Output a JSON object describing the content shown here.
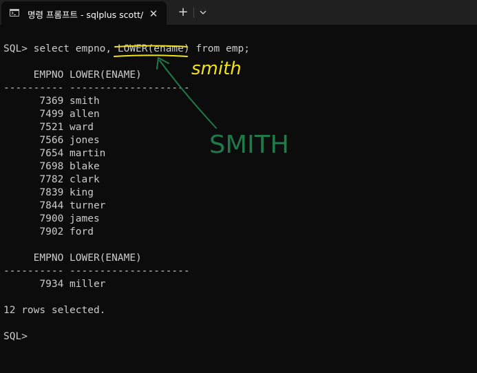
{
  "tab": {
    "title": "명령 프롬프트 - sqlplus  scott/",
    "close_glyph": "✕",
    "new_tab_glyph": "+"
  },
  "terminal": {
    "lines": [
      "SQL> select empno, LOWER(ename) from emp;",
      "",
      "     EMPNO LOWER(ENAME)",
      "---------- --------------------",
      "      7369 smith",
      "      7499 allen",
      "      7521 ward",
      "      7566 jones",
      "      7654 martin",
      "      7698 blake",
      "      7782 clark",
      "      7839 king",
      "      7844 turner",
      "      7900 james",
      "      7902 ford",
      "",
      "     EMPNO LOWER(ENAME)",
      "---------- --------------------",
      "      7934 miller",
      "",
      "12 rows selected.",
      "",
      "SQL>"
    ]
  },
  "annotations": {
    "handwritten_lower": "smith",
    "handwritten_upper": "SMITH",
    "yellow_color": "#f2e21c",
    "green_color": "#1f7a4a"
  }
}
